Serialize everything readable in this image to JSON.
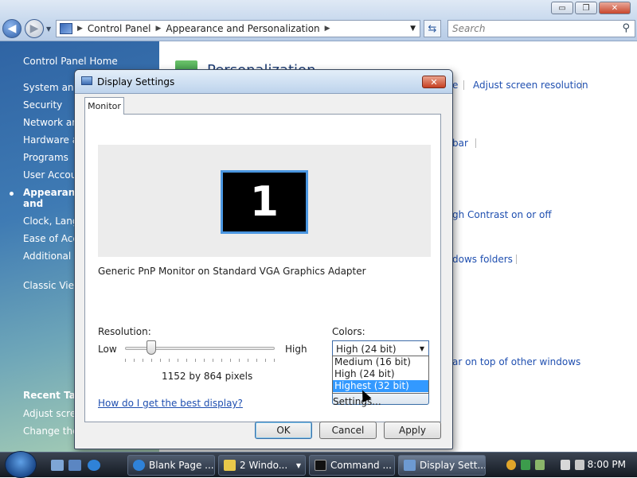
{
  "window": {
    "minimize_label": "▭",
    "maximize_label": "❐",
    "close_label": "✕"
  },
  "address_bar": {
    "crumbs": [
      "Control Panel",
      "Appearance and Personalization"
    ]
  },
  "search": {
    "placeholder": "Search"
  },
  "left_pane": {
    "items": [
      {
        "label": "Control Panel Home"
      },
      {
        "label": "System and Maintenance"
      },
      {
        "label": "Security"
      },
      {
        "label": "Network and Internet"
      },
      {
        "label": "Hardware and Sound"
      },
      {
        "label": "Programs"
      },
      {
        "label": "User Accounts"
      },
      {
        "label": "Appearance and Personalization"
      },
      {
        "label": "Clock, Language, and Region"
      },
      {
        "label": "Ease of Access"
      },
      {
        "label": "Additional Options"
      },
      {
        "label": "Classic View"
      },
      {
        "label": "Recent Tasks"
      },
      {
        "label": "Adjust screen resolution"
      },
      {
        "label": "Change the"
      }
    ]
  },
  "main": {
    "title": "Personalization",
    "links": [
      "e",
      "Adjust screen resolution",
      "bar",
      "gh Contrast on or off",
      "dows folders",
      "ar on top of other windows"
    ]
  },
  "dialog": {
    "title": "Display Settings",
    "close_label": "✕",
    "tab": "Monitor",
    "monitor_number": "1",
    "adapter": "Generic PnP Monitor on Standard VGA Graphics Adapter",
    "resolution_label": "Resolution:",
    "low_label": "Low",
    "high_label": "High",
    "resolution_value": "1152 by 864 pixels",
    "colors_label": "Colors:",
    "colors_selected": "High (24 bit)",
    "colors_options": [
      "Medium (16 bit)",
      "High (24 bit)",
      "Highest (32 bit)"
    ],
    "help_link": "How do I get the best display?",
    "advanced_button": "Advanced Settings...",
    "ok_button": "OK",
    "cancel_button": "Cancel",
    "apply_button": "Apply"
  },
  "taskbar": {
    "tasks": [
      {
        "label": "Blank Page ..."
      },
      {
        "label": "2 Windo..."
      },
      {
        "label": "Command ..."
      },
      {
        "label": "Display Sett..."
      }
    ],
    "clock": "8:00 PM"
  }
}
